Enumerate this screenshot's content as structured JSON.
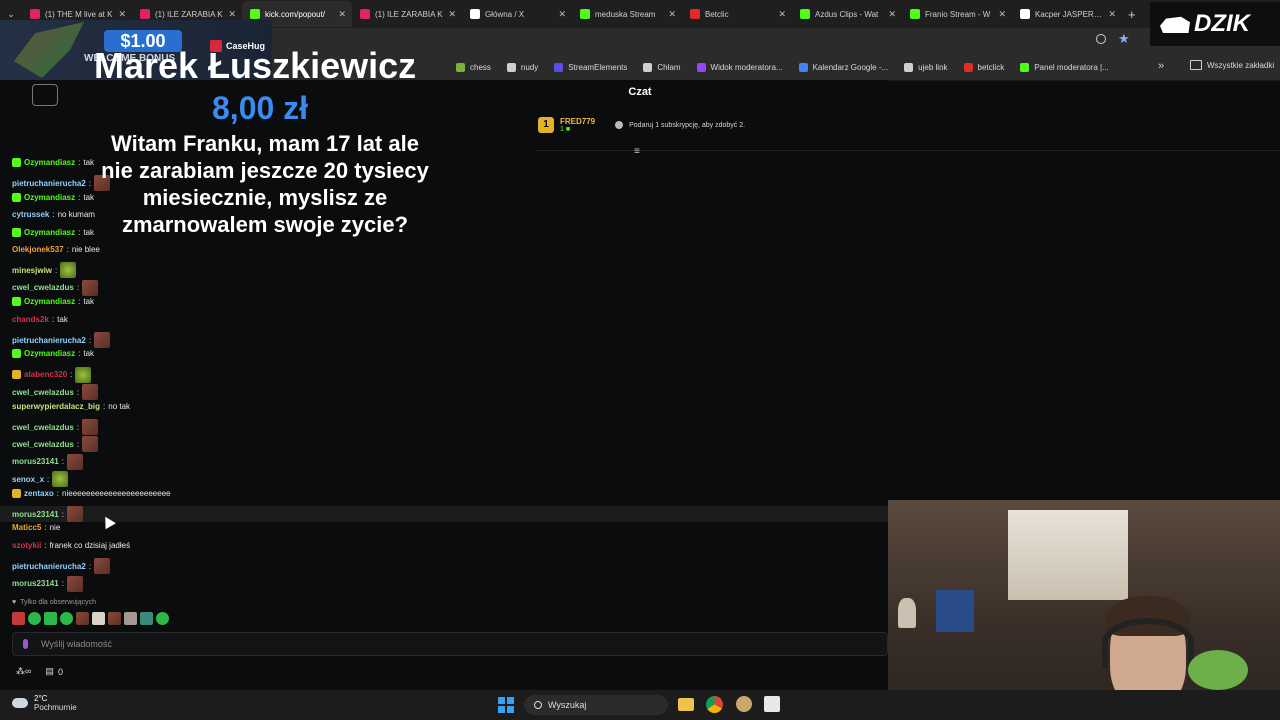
{
  "tabs": [
    {
      "label": "(1) THE M live at K",
      "color": "#e0245e",
      "active": false
    },
    {
      "label": "(1) ILE ZARABIA K",
      "color": "#e0245e",
      "active": false
    },
    {
      "label": "kick.com/popout/",
      "color": "#53fc18",
      "active": true
    },
    {
      "label": "(1) ILE ZARABIA K",
      "color": "#e0245e",
      "active": false
    },
    {
      "label": "Główna / X",
      "color": "#ffffff",
      "active": false
    },
    {
      "label": "meduska Stream",
      "color": "#53fc18",
      "active": false
    },
    {
      "label": "Betclic",
      "color": "#e22a2a",
      "active": false
    },
    {
      "label": "Azdus Clips - Wat",
      "color": "#53fc18",
      "active": false
    },
    {
      "label": "Franio Stream - W",
      "color": "#53fc18",
      "active": false
    },
    {
      "label": "Kacper JASPER Pe",
      "color": "#ffffff",
      "active": false
    }
  ],
  "bookmarks": [
    {
      "label": "chess",
      "color": "#7ab33b"
    },
    {
      "label": "nudy",
      "color": "#cfcfcf"
    },
    {
      "label": "StreamElements",
      "color": "#5b4ee6"
    },
    {
      "label": "Chłam",
      "color": "#cfcfcf"
    },
    {
      "label": "Widok moderatora...",
      "color": "#9147ff"
    },
    {
      "label": "Kalendarz Google -...",
      "color": "#4285f4"
    },
    {
      "label": "ujeb link",
      "color": "#cfcfcf"
    },
    {
      "label": "betclick",
      "color": "#e22a2a"
    },
    {
      "label": "Panel moderatora |...",
      "color": "#53fc18"
    },
    {
      "label": "Wszystkie zakładki",
      "color": "#cfcfcf"
    }
  ],
  "ad": {
    "price": "$1.00",
    "brand": "CaseHug",
    "bonus": "WELCOME BONUS"
  },
  "watermark": "DZIK",
  "chat_title": "Czat",
  "pinned": {
    "user": "FRED779",
    "rank": "1",
    "text": "Podaruj 1 subskrypcję, aby zdobyć 2."
  },
  "donation": {
    "name": "Marek Łuszkiewicz",
    "amount": "8,00 zł",
    "message": "Witam Franku, mam 17 lat ale nie zarabiam jeszcze 20 tysiecy miesiecznie, myslisz ze zmarnowalem swoje zycie?"
  },
  "messages": [
    {
      "user": "Ozymandiasz",
      "text": "tak",
      "color": "#53fc18",
      "badge": true
    },
    {
      "user": "pietruchanierucha2",
      "text": "",
      "color": "#8fd3ff",
      "emote": true
    },
    {
      "user": "Ozymandiasz",
      "text": "tak",
      "color": "#53fc18",
      "badge": true
    },
    {
      "user": "cytrussek",
      "text": "no kumam",
      "color": "#8fd3ff"
    },
    {
      "user": "Ozymandiasz",
      "text": "tak",
      "color": "#53fc18",
      "badge": true
    },
    {
      "user": "Olekjonek537",
      "text": "nie blee",
      "color": "#f2a13a"
    },
    {
      "user": "minesjwiw",
      "text": "",
      "color": "#c6e37c",
      "emote": true,
      "green": true
    },
    {
      "user": "cwel_cwelazdus",
      "text": "",
      "color": "#8fe08f",
      "emote": true
    },
    {
      "user": "Ozymandiasz",
      "text": "tak",
      "color": "#53fc18",
      "badge": true
    },
    {
      "user": "chands2k",
      "text": "tak",
      "color": "#d6304a"
    },
    {
      "user": "pietruchanierucha2",
      "text": "",
      "color": "#8fd3ff",
      "emote": true
    },
    {
      "user": "Ozymandiasz",
      "text": "tak",
      "color": "#53fc18",
      "badge": true
    },
    {
      "user": "alabenc320",
      "text": "",
      "color": "#d6304a",
      "emote": true,
      "green": true,
      "badge": true
    },
    {
      "user": "cwel_cwelazdus",
      "text": "",
      "color": "#8fe08f",
      "emote": true
    },
    {
      "user": "superwypierdalacz_big",
      "text": "no tak",
      "color": "#c6e37c"
    },
    {
      "user": "cwel_cwelazdus",
      "text": "",
      "color": "#8fe08f",
      "emote": true
    },
    {
      "user": "cwel_cwelazdus",
      "text": "",
      "color": "#8fe08f",
      "emote": true
    },
    {
      "user": "morus23141",
      "text": "",
      "color": "#8fe08f",
      "emote": true
    },
    {
      "user": "senox_x",
      "text": "",
      "color": "#8fd3ff",
      "emote": true,
      "green": true
    },
    {
      "user": "zentaxo",
      "text": "nieeeeeeeeeeeeeeeeeeeeeee",
      "color": "#8fd3ff",
      "badge": true
    },
    {
      "user": "morus23141",
      "text": "",
      "color": "#8fe08f",
      "emote": true
    },
    {
      "user": "Maticc5",
      "text": "nie",
      "color": "#f2a13a"
    },
    {
      "user": "szotykii",
      "text": "franek co dzisiaj jadłeś",
      "color": "#d6304a"
    },
    {
      "user": "pietruchanierucha2",
      "text": "",
      "color": "#8fd3ff",
      "emote": true
    },
    {
      "user": "morus23141",
      "text": "",
      "color": "#8fe08f",
      "emote": true
    }
  ],
  "followers_only": "Tylko dla obserwujących",
  "input_placeholder": "Wyślij wiadomość",
  "footer_count": "0",
  "weather": {
    "temp": "2°C",
    "desc": "Pochmurnie"
  },
  "search_label": "Wyszukaj"
}
